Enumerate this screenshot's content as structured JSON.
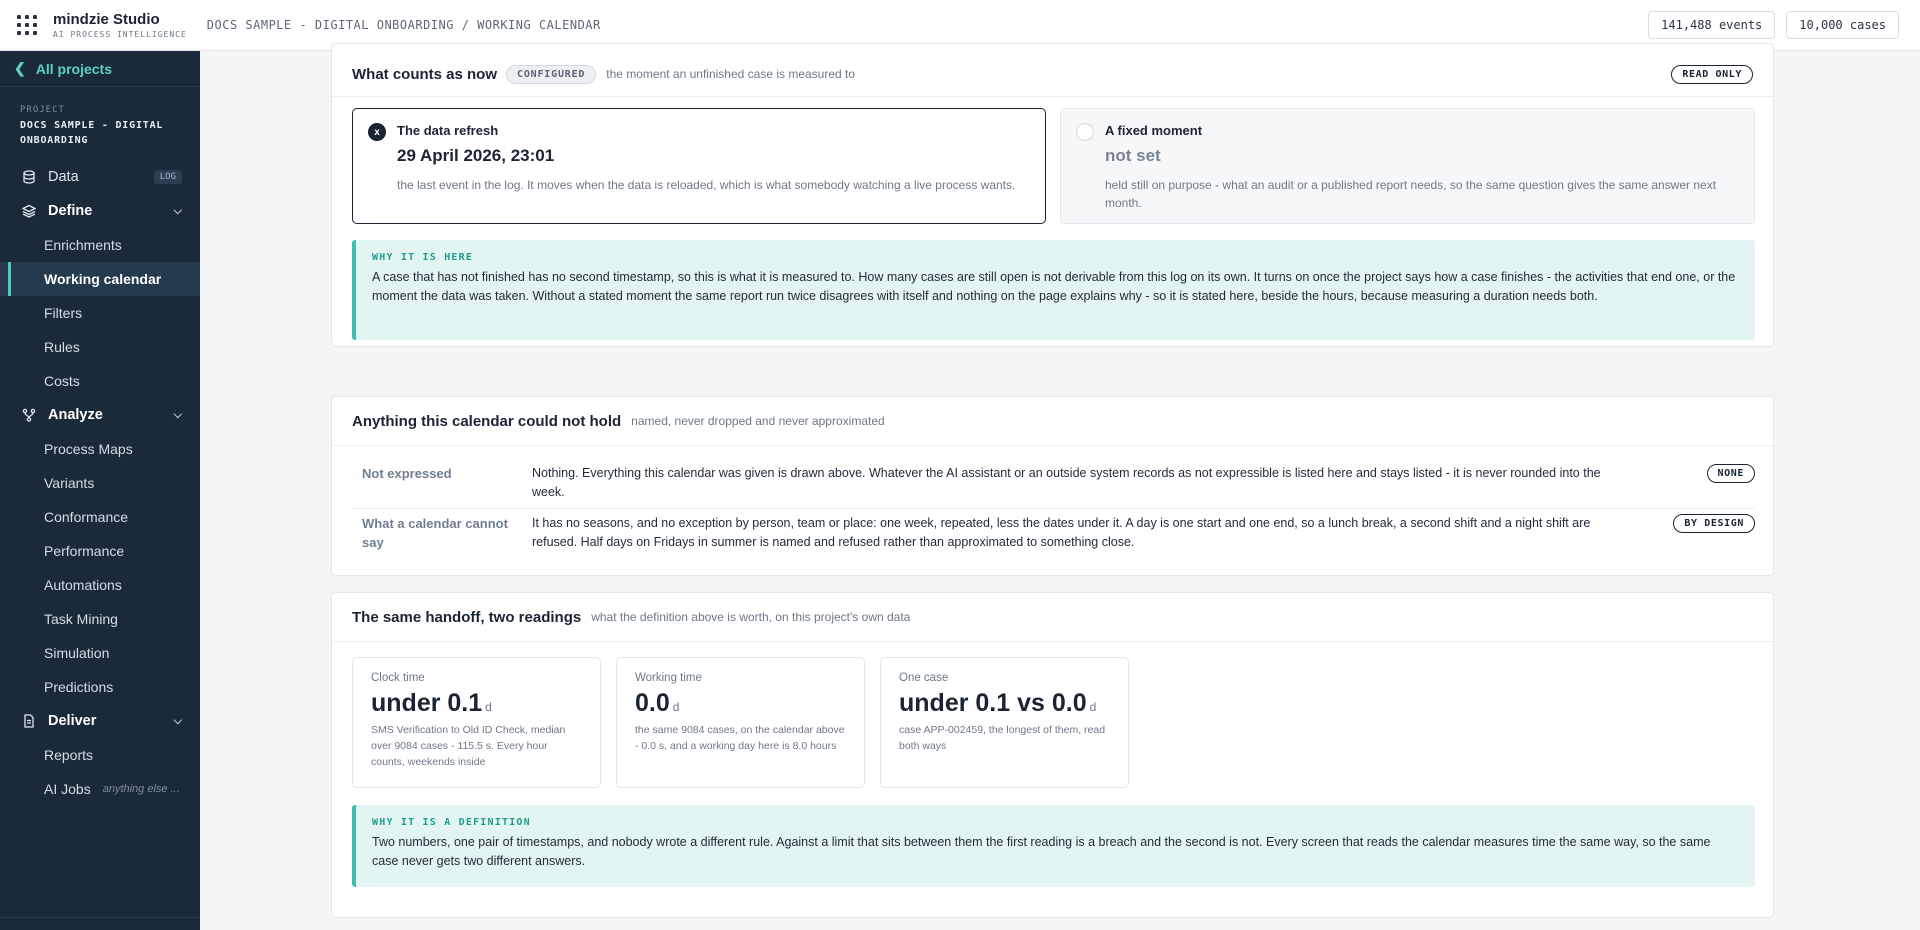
{
  "topbar": {
    "brand_name": "mindzie Studio",
    "brand_sub": "AI PROCESS INTELLIGENCE",
    "breadcrumb": "DOCS SAMPLE - DIGITAL ONBOARDING / WORKING CALENDAR",
    "events": "141,488 events",
    "cases": "10,000 cases"
  },
  "sidebar": {
    "back": "All projects",
    "project_label": "PROJECT",
    "project_name": "DOCS SAMPLE - DIGITAL ONBOARDING",
    "data": "Data",
    "data_badge": "LOG",
    "define": "Define",
    "define_items": [
      "Enrichments",
      "Working calendar",
      "Filters",
      "Rules",
      "Costs"
    ],
    "analyze": "Analyze",
    "analyze_items": [
      "Process Maps",
      "Variants",
      "Conformance",
      "Performance",
      "Automations",
      "Task Mining",
      "Simulation",
      "Predictions"
    ],
    "deliver": "Deliver",
    "deliver_items": [
      "Reports",
      "AI Jobs"
    ],
    "ai_jobs_hint": "anything else ..."
  },
  "now_panel": {
    "title": "What counts as now",
    "status_chip": "CONFIGURED",
    "subtitle": "the moment an unfinished case is measured to",
    "read_only": "READ ONLY",
    "option_selected": {
      "marker": "x",
      "title": "The data refresh",
      "value": "29 April 2026, 23:01",
      "desc": "the last event in the log. It moves when the data is reloaded, which is what somebody watching a live process wants."
    },
    "option_other": {
      "title": "A fixed moment",
      "value": "not set",
      "desc": "held still on purpose - what an audit or a published report needs, so the same question gives the same answer next month."
    },
    "callout_label": "WHY IT IS HERE",
    "callout_text": "A case that has not finished has no second timestamp, so this is what it is measured to. How many cases are still open is not derivable from this log on its own. It turns on once the project says how a case finishes - the activities that end one, or the moment the data was taken. Without a stated moment the same report run twice disagrees with itself and nothing on the page explains why - so it is stated here, beside the hours, because measuring a duration needs both."
  },
  "limits_panel": {
    "title": "Anything this calendar could not hold",
    "subtitle": "named, never dropped and never approximated",
    "rows": [
      {
        "label": "Not expressed",
        "text": "Nothing. Everything this calendar was given is drawn above. Whatever the AI assistant or an outside system records as not expressible is listed here and stays listed - it is never rounded into the week.",
        "chip": "NONE"
      },
      {
        "label": "What a calendar cannot say",
        "text": "It has no seasons, and no exception by person, team or place: one week, repeated, less the dates under it. A day is one start and one end, so a lunch break, a second shift and a night shift are refused. Half days on Fridays in summer is named and refused rather than approximated to something close.",
        "chip": "BY DESIGN"
      }
    ]
  },
  "handoff_panel": {
    "title": "The same handoff, two readings",
    "subtitle": "what the definition above is worth, on this project's own data",
    "cards": [
      {
        "label": "Clock time",
        "value": "under 0.1",
        "unit": "d",
        "desc": "SMS Verification to Old ID Check, median over 9084 cases - 115.5 s. Every hour counts, weekends inside"
      },
      {
        "label": "Working time",
        "value": "0.0",
        "unit": "d",
        "desc": "the same 9084 cases, on the calendar above - 0.0 s, and a working day here is 8.0 hours"
      },
      {
        "label": "One case",
        "value": "under 0.1 vs 0.0",
        "unit": "d",
        "desc": "case APP-002459, the longest of them, read both ways"
      }
    ],
    "callout_label": "WHY IT IS A DEFINITION",
    "callout_text": "Two numbers, one pair of timestamps, and nobody wrote a different rule. Against a limit that sits between them the first reading is a breach and the second is not. Every screen that reads the calendar measures time the same way, so the same case never gets two different answers."
  }
}
